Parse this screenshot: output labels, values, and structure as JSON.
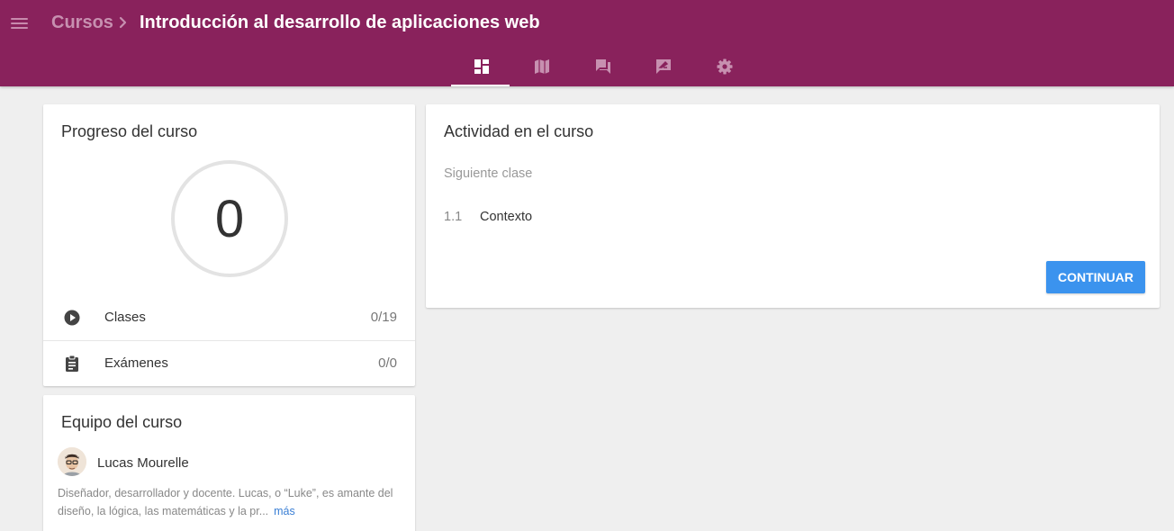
{
  "header": {
    "breadcrumb_root": "Cursos",
    "title": "Introducción al desarrollo de aplicaciones web",
    "background": "#89225c",
    "tabs": [
      {
        "icon": "dashboard-icon",
        "active": true
      },
      {
        "icon": "map-icon",
        "active": false
      },
      {
        "icon": "forum-icon",
        "active": false
      },
      {
        "icon": "rate-review-icon",
        "active": false
      },
      {
        "icon": "settings-icon",
        "active": false
      }
    ]
  },
  "progress": {
    "title": "Progreso del curso",
    "value": "0",
    "rows": [
      {
        "icon": "play-circle-icon",
        "label": "Clases",
        "value": "0/19"
      },
      {
        "icon": "assignment-icon",
        "label": "Exámenes",
        "value": "0/0"
      }
    ]
  },
  "team": {
    "title": "Equipo del curso",
    "member_name": "Lucas Mourelle",
    "bio": "Diseñador, desarrollador y docente. Lucas, o “Luke”, es amante del diseño, la lógica, las matemáticas y la pr...",
    "more_label": "más"
  },
  "activity": {
    "title": "Actividad en el curso",
    "next_label": "Siguiente clase",
    "lesson_number": "1.1",
    "lesson_name": "Contexto",
    "continue_label": "CONTINUAR",
    "accent": "#3b93ee"
  }
}
